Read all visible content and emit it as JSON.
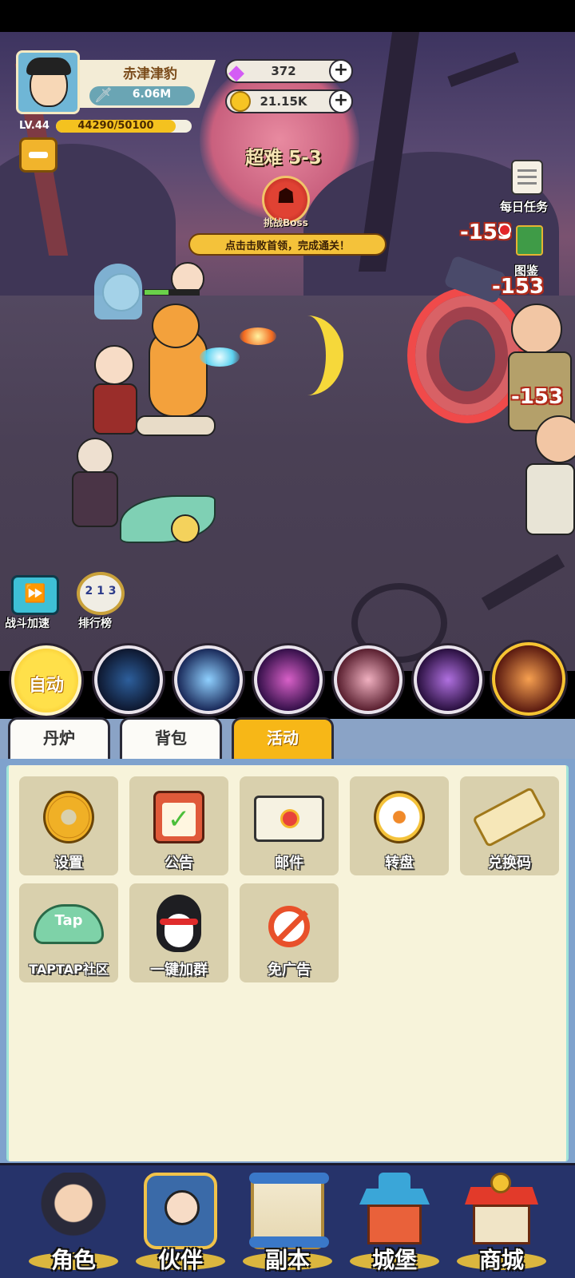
{
  "player": {
    "name": "赤津津豹",
    "power": "6.06M",
    "level": "LV.44",
    "exp_text": "44290/50100",
    "exp_fraction": 0.884
  },
  "currency": {
    "gems": "372",
    "coins": "21.15K",
    "add_symbol": "+"
  },
  "stage": {
    "label": "超难 5-3",
    "boss_label": "挑战Boss",
    "hint": "点击击败首领，完成通关！"
  },
  "side_right": {
    "daily_task": "每日任务",
    "atlas": "图鉴"
  },
  "damage_numbers": [
    "-153",
    "-153",
    "-153"
  ],
  "side_left": {
    "speed_label": "战斗加速",
    "rank_label": "排行榜",
    "rank_digits": "2 1 3"
  },
  "skillbar": {
    "auto_label": "自动"
  },
  "tabs": [
    {
      "label": "丹炉",
      "active": false
    },
    {
      "label": "背包",
      "active": false
    },
    {
      "label": "活动",
      "active": true
    }
  ],
  "activity_tiles": [
    {
      "label": "设置",
      "icon": "gear-icon"
    },
    {
      "label": "公告",
      "icon": "clipboard-icon"
    },
    {
      "label": "邮件",
      "icon": "mail-icon"
    },
    {
      "label": "转盘",
      "icon": "wheel-icon"
    },
    {
      "label": "兑换码",
      "icon": "ticket-icon"
    },
    {
      "label": "TAPTAP社区",
      "icon": "taptap-icon"
    },
    {
      "label": "一键加群",
      "icon": "penguin-icon"
    },
    {
      "label": "免广告",
      "icon": "no-ads-icon"
    }
  ],
  "bottom_nav": [
    {
      "label": "角色",
      "icon": "character-icon"
    },
    {
      "label": "伙伴",
      "icon": "partner-icon"
    },
    {
      "label": "副本",
      "icon": "dungeon-scroll-icon"
    },
    {
      "label": "城堡",
      "icon": "castle-icon"
    },
    {
      "label": "商城",
      "icon": "shop-icon"
    }
  ],
  "colors": {
    "accent": "#f7b717",
    "panel_bg": "#f7f3da",
    "nav_bg": "#26336a"
  }
}
